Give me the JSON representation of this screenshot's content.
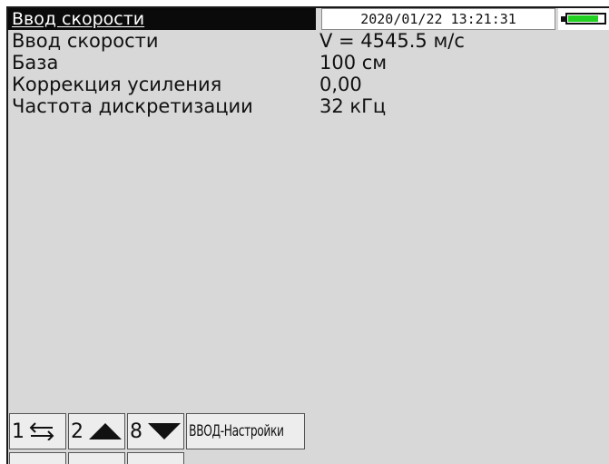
{
  "header": {
    "title": "Ввод скорости",
    "datetime": "2020/01/22  13:21:31",
    "battery_level": 0.85,
    "battery_color": "#22d022"
  },
  "params": [
    {
      "label": "Ввод скорости",
      "value": "V = 4545.5 м/с"
    },
    {
      "label": "База",
      "value": "100 см"
    },
    {
      "label": "Коррекция усиления",
      "value": "0,00"
    },
    {
      "label": "Частота дискретизации",
      "value": "32 кГц"
    }
  ],
  "keys": [
    {
      "num": "1",
      "icon": "back-arrow-icon"
    },
    {
      "num": "2",
      "icon": "up-triangle-icon"
    },
    {
      "num": "8",
      "icon": "down-triangle-icon"
    },
    {
      "text": "ВВОД-Настройки"
    }
  ]
}
